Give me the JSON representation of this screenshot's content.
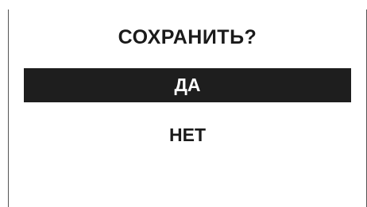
{
  "dialog": {
    "title": "СОХРАНИТЬ?",
    "options": [
      {
        "label": "ДА",
        "selected": true
      },
      {
        "label": "НЕТ",
        "selected": false
      }
    ]
  },
  "colors": {
    "background": "#ffffff",
    "text": "#1a1a1a",
    "selection_bg": "#1e1e1e",
    "selection_text": "#ffffff",
    "frame": "#555555"
  }
}
